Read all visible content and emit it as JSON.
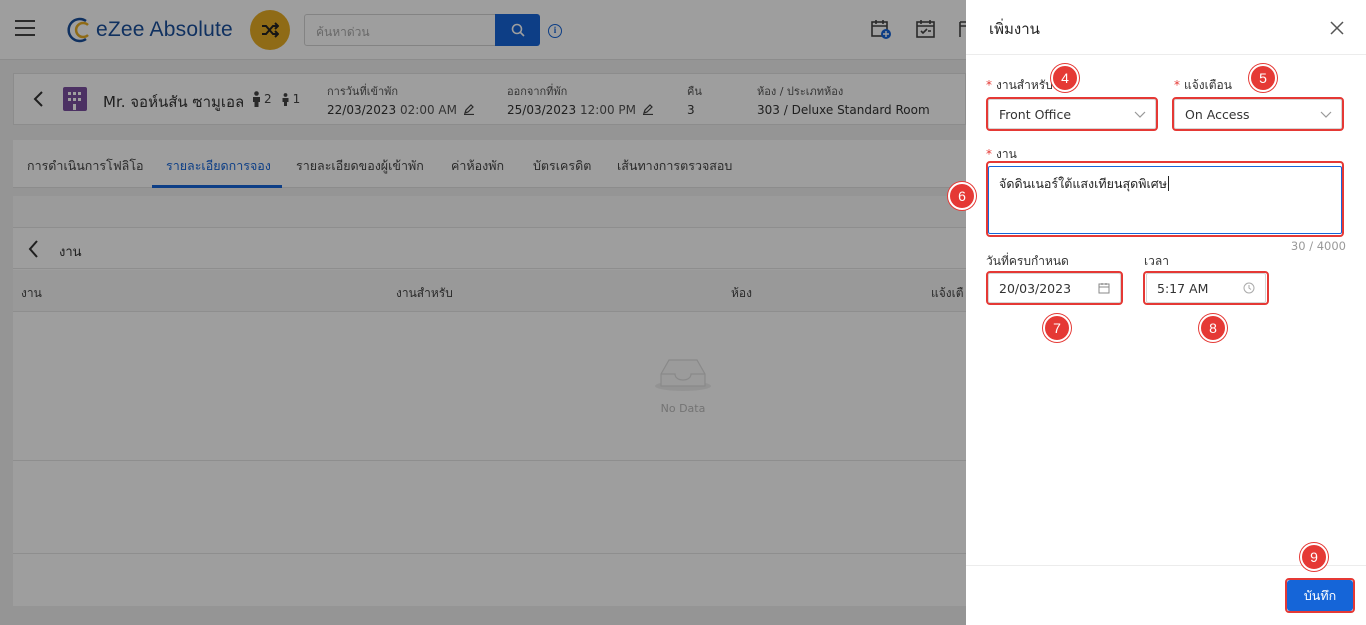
{
  "header": {
    "app_name": "eZee Absolute",
    "search_placeholder": "ค้นหาด่วน",
    "info_glyph": "i"
  },
  "guest": {
    "name": "Mr. จอห์นสัน ซามูเอล",
    "adults": "2",
    "children": "1",
    "checkin_label": "การวันที่เข้าพัก",
    "checkin_date": "22/03/2023",
    "checkin_time": "02:00 AM",
    "checkout_label": "ออกจากที่พัก",
    "checkout_date": "25/03/2023",
    "checkout_time": "12:00 PM",
    "nights_label": "คืน",
    "nights": "3",
    "room_label": "ห้อง / ประเภทห้อง",
    "room": "303 / Deluxe Standard Room"
  },
  "tabs": [
    {
      "label": "การดำเนินการโฟลิโอ"
    },
    {
      "label": "รายละเอียดการจอง"
    },
    {
      "label": "รายละเอียดของผู้เข้าพัก"
    },
    {
      "label": "ค่าห้องพัก"
    },
    {
      "label": "บัตรเครดิต"
    },
    {
      "label": "เส้นทางการตรวจสอบ"
    }
  ],
  "tasks_panel": {
    "title": "งาน",
    "columns": [
      "งาน",
      "งานสำหรับ",
      "ห้อง",
      "แจ้งเตื"
    ],
    "empty_text": "No Data"
  },
  "drawer": {
    "title": "เพิ่มงาน",
    "task_for_label": "งานสำหรับ",
    "task_for_value": "Front Office",
    "notify_label": "แจ้งเตือน",
    "notify_value": "On Access",
    "task_label": "งาน",
    "task_value": "จัดดินเนอร์ใต้แสงเทียนสุดพิเศษ",
    "char_counter": "30 / 4000",
    "due_date_label": "วันที่ครบกำหนด",
    "due_date_value": "20/03/2023",
    "time_label": "เวลา",
    "time_value": "5:17 AM",
    "save_label": "บันทึก",
    "required_mark": "*"
  },
  "callouts": [
    "4",
    "5",
    "6",
    "7",
    "8",
    "9"
  ],
  "colors": {
    "brand_blue": "#1565d8",
    "callout_red": "#e53935",
    "shuffle_gold": "#e7ad25",
    "building_purple": "#7b4fa0"
  }
}
